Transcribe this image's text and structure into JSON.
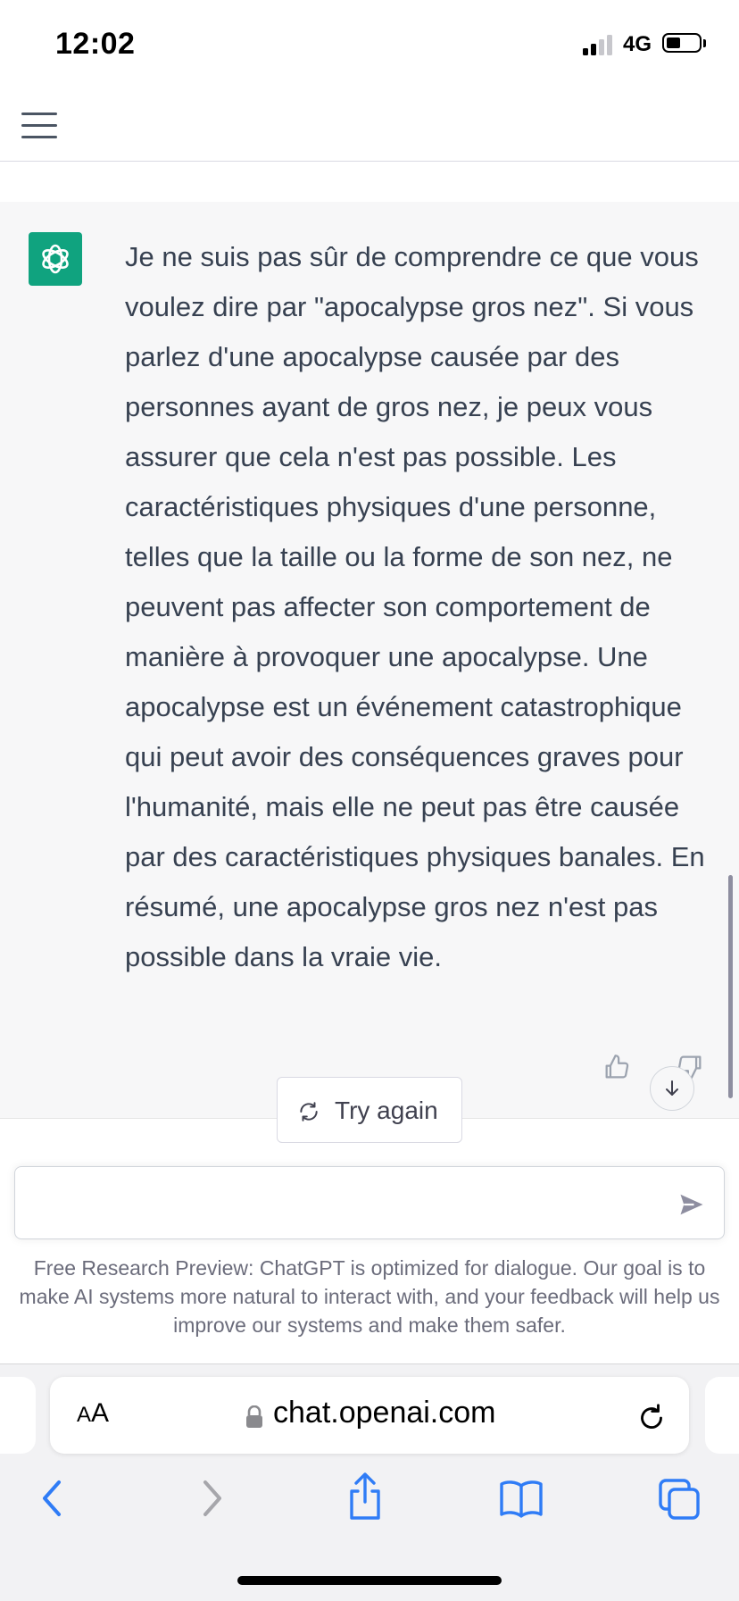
{
  "status_bar": {
    "time": "12:02",
    "network": "4G"
  },
  "message": {
    "text": "Je ne suis pas sûr de comprendre ce que vous voulez dire par \"apocalypse gros nez\". Si vous parlez d'une apocalypse causée par des personnes ayant de gros nez, je peux vous assurer que cela n'est pas possible. Les caractéristiques physiques d'une personne, telles que la taille ou la forme de son nez, ne peuvent pas affecter son comportement de manière à provoquer une apocalypse. Une apocalypse est un événement catastrophique qui peut avoir des conséquences graves pour l'humanité, mais elle ne peut pas être causée par des caractéristiques physiques banales. En résumé, une apocalypse gros nez n'est pas possible dans la vraie vie."
  },
  "composer": {
    "try_again_label": "Try again",
    "input_value": "",
    "disclaimer": "Free Research Preview: ChatGPT is optimized for dialogue. Our goal is to make AI systems more natural to interact with, and your feedback will help us improve our systems and make them safer."
  },
  "browser": {
    "aa_small": "A",
    "aa_big": "A",
    "url": "chat.openai.com"
  },
  "colors": {
    "brand_green": "#10a37f",
    "ios_blue": "#2f7cf6",
    "ios_disabled": "#a6a6ab"
  },
  "icons": {
    "menu": "menu-icon",
    "avatar": "openai-logo-icon",
    "thumb_up": "thumb-up-icon",
    "thumb_down": "thumb-down-icon",
    "scroll_down": "arrow-down-icon",
    "try_again": "refresh-icon",
    "send": "send-icon",
    "lock": "lock-icon",
    "reload": "reload-icon",
    "back": "chevron-left-icon",
    "forward": "chevron-right-icon",
    "share": "share-icon",
    "bookmarks": "book-icon",
    "tabs": "tabs-icon"
  }
}
